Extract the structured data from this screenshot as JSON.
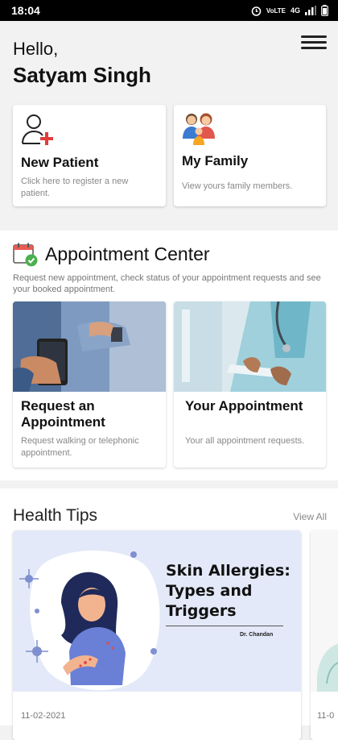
{
  "status": {
    "time": "18:04",
    "network": "VoLTE",
    "signal_type": "4G"
  },
  "greeting": {
    "hello": "Hello,",
    "name": "Satyam Singh"
  },
  "quick_cards": [
    {
      "title": "New Patient",
      "subtitle": "Click here to register a new patient."
    },
    {
      "title": "My Family",
      "subtitle": "View yours family members."
    }
  ],
  "appointment_center": {
    "title": "Appointment Center",
    "description": "Request new appointment, check status of your appointment requests and see your booked appointment.",
    "cards": [
      {
        "title": "Request an Appointment",
        "subtitle": "Request walking or telephonic appointment."
      },
      {
        "title": "Your Appointment",
        "subtitle": "Your all appointment requests."
      }
    ]
  },
  "health_tips": {
    "title": "Health Tips",
    "view_all": "View All",
    "articles": [
      {
        "headline_line1": "Skin Allergies:",
        "headline_line2": "Types and",
        "headline_line3": "Triggers",
        "author": "Dr. Chandan",
        "date": "11-02-2021"
      },
      {
        "date": "11-0"
      }
    ]
  },
  "colors": {
    "accent": "#e23b3b",
    "tip_bg": "#e3e9f8",
    "statusbar": "#000000"
  }
}
